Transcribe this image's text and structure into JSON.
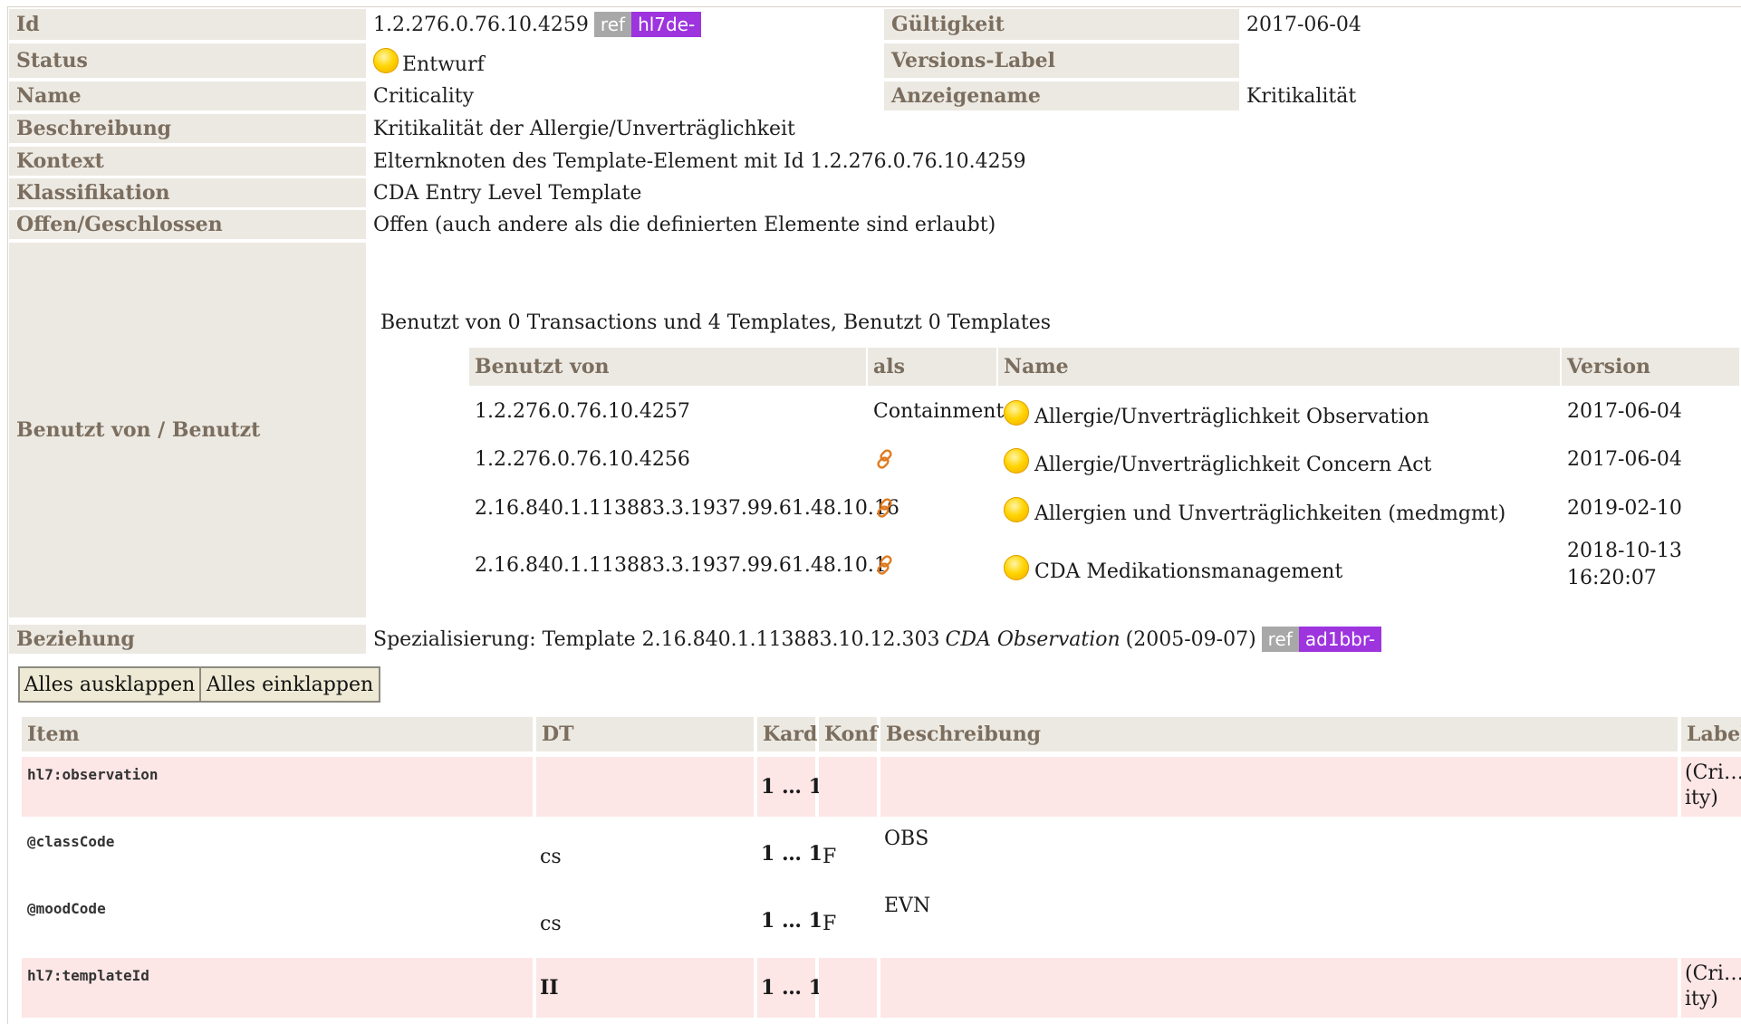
{
  "meta": {
    "id_label": "Id",
    "id_value": "1.2.276.0.76.10.4259",
    "id_badge_ref": "ref",
    "id_badge_prefix": "hl7de-",
    "validity_label": "Gültigkeit",
    "validity_value": "2017-06-04",
    "status_label": "Status",
    "status_value": "Entwurf",
    "version_label": "Versions-Label",
    "version_value": "",
    "name_label": "Name",
    "name_value": "Criticality",
    "display_label": "Anzeigename",
    "display_value": "Kritikalität",
    "description_label": "Beschreibung",
    "description_value": "Kritikalität der Allergie/Unverträglichkeit",
    "context_label": "Kontext",
    "context_value": "Elternknoten des Template-Element mit Id 1.2.276.0.76.10.4259",
    "classification_label": "Klassifikation",
    "classification_value": "CDA Entry Level Template",
    "open_label": "Offen/Geschlossen",
    "open_value": "Offen (auch andere als die definierten Elemente sind erlaubt)",
    "usage_label": "Benutzt von / Benutzt",
    "usage_summary": "Benutzt von 0 Transactions und 4 Templates, Benutzt 0 Templates",
    "relation_label": "Beziehung",
    "relation_prefix": "Spezialisierung: Template 2.16.840.1.113883.10.12.303",
    "relation_name": "CDA Observation",
    "relation_date": "(2005-09-07)",
    "relation_badge_ref": "ref",
    "relation_badge_prefix": "ad1bbr-"
  },
  "usage_table": {
    "headers": [
      "Benutzt von",
      "als",
      "Name",
      "Version"
    ],
    "rows": [
      {
        "id": "1.2.276.0.76.10.4257",
        "as": "Containment",
        "name": "Allergie/Unverträglichkeit Observation",
        "version": "2017-06-04"
      },
      {
        "id": "1.2.276.0.76.10.4256",
        "as": "",
        "name": "Allergie/Unverträglichkeit Concern Act",
        "version": "2017-06-04"
      },
      {
        "id": "2.16.840.1.113883.3.1937.99.61.48.10.16",
        "as": "",
        "name": "Allergien und Unverträglichkeiten (medmgmt)",
        "version": "2019-02-10"
      },
      {
        "id": "2.16.840.1.113883.3.1937.99.61.48.10.1",
        "as": "",
        "name": "CDA Medikationsmanagement",
        "version": "2018-10-13",
        "version2": "16:20:07"
      }
    ]
  },
  "buttons": {
    "expand_all": "Alles ausklappen",
    "collapse_all": "Alles einklappen"
  },
  "items_table": {
    "headers": [
      "Item",
      "DT",
      "Kard",
      "Konf",
      "Beschreibung",
      "Label"
    ],
    "rows": [
      {
        "item": "hl7:observation",
        "dt": "",
        "card": "1 … 1",
        "conf": "",
        "desc": "",
        "label1": "(Cri…",
        "label2": "ity)"
      },
      {
        "item": "@classCode",
        "dt": "cs",
        "card": "1 … 1",
        "conf": "F",
        "desc": "OBS",
        "label1": "",
        "label2": ""
      },
      {
        "item": "@moodCode",
        "dt": "cs",
        "card": "1 … 1",
        "conf": "F",
        "desc": "EVN",
        "label1": "",
        "label2": ""
      },
      {
        "item": "hl7:templateId",
        "dt": "II",
        "card": "1 … 1",
        "conf": "",
        "desc": "",
        "label1": "(Cri…",
        "label2": "ity)"
      }
    ]
  },
  "colors": {
    "label_bg": "#ece9e2",
    "label_text": "#7b6e5f",
    "ref_badge": "#a8a8a8",
    "prefix_badge": "#9d34de",
    "pink_row": "#fde6e6",
    "status_dot": "#ffd400",
    "link_icon": "#e07a20"
  },
  "icons": {
    "status": "status-draft-dot-icon",
    "link": "chain-link-icon"
  }
}
